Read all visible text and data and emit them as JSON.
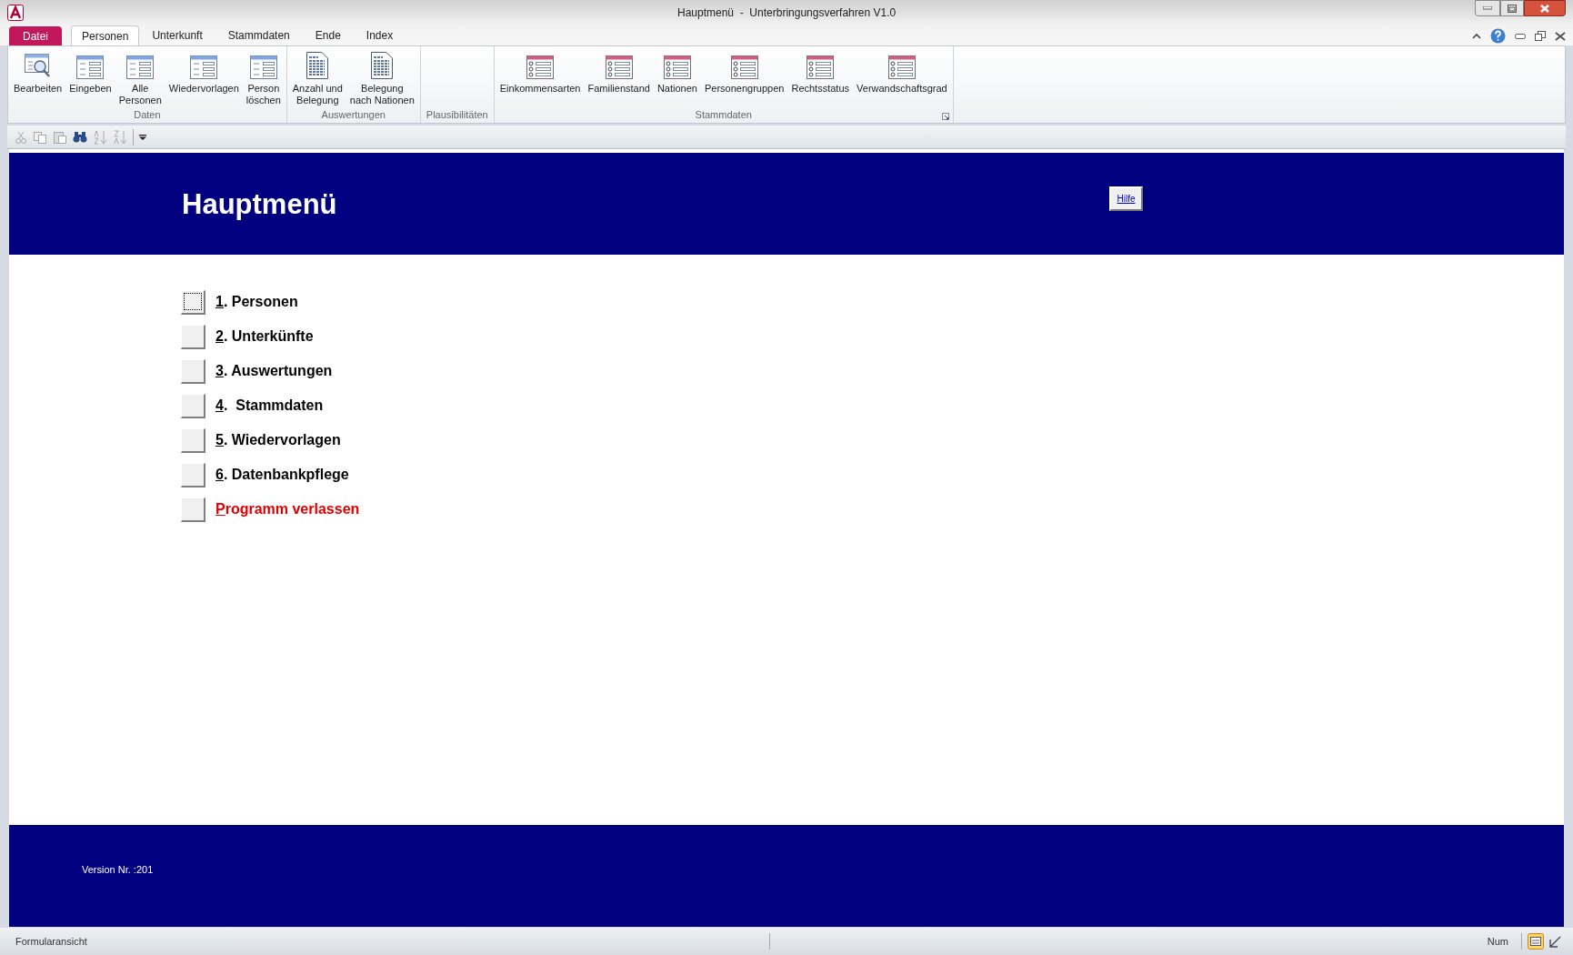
{
  "window": {
    "title": "Hauptmenü  -  Unterbringungsverfahren V1.0"
  },
  "file_tab": {
    "label": "Datei"
  },
  "tabs": [
    {
      "label": "Personen",
      "selected": true
    },
    {
      "label": "Unterkunft",
      "selected": false
    },
    {
      "label": "Stammdaten",
      "selected": false
    },
    {
      "label": "Ende",
      "selected": false
    },
    {
      "label": "Index",
      "selected": false
    }
  ],
  "ribbon_groups": [
    {
      "label": "Daten",
      "items": [
        {
          "label": "Bearbeiten",
          "kind": "search"
        },
        {
          "label": "Eingeben",
          "kind": "form"
        },
        {
          "label": "Alle\nPersonen",
          "kind": "form"
        },
        {
          "label": "Wiedervorlagen",
          "kind": "form"
        },
        {
          "label": "Person\nlöschen",
          "kind": "form"
        }
      ]
    },
    {
      "label": "Auswertungen",
      "items": [
        {
          "label": "Anzahl und\nBelegung",
          "kind": "report"
        },
        {
          "label": "Belegung\nnach Nationen",
          "kind": "report"
        }
      ]
    },
    {
      "label": "Plausibilitäten"
    },
    {
      "label": "Stammdaten",
      "launcher": true,
      "items": [
        {
          "label": "Einkommensarten",
          "kind": "table"
        },
        {
          "label": "Familienstand",
          "kind": "table"
        },
        {
          "label": "Nationen",
          "kind": "table"
        },
        {
          "label": "Personengruppen",
          "kind": "table"
        },
        {
          "label": "Rechtsstatus",
          "kind": "table"
        },
        {
          "label": "Verwandschaftsgrad",
          "kind": "table"
        }
      ]
    }
  ],
  "form": {
    "title": "Hauptmenü",
    "help_button": "Hilfe",
    "menu": [
      {
        "key": "1",
        "rest": ". Personen",
        "kind": "normal",
        "focused": true
      },
      {
        "key": "2",
        "rest": ". Unterkünfte",
        "kind": "normal",
        "focused": false
      },
      {
        "key": "3",
        "rest": ". Auswertungen",
        "kind": "normal",
        "focused": false
      },
      {
        "key": "4",
        "rest": ".  Stammdaten",
        "kind": "normal",
        "focused": false
      },
      {
        "key": "5",
        "rest": ". Wiedervorlagen",
        "kind": "normal",
        "focused": false
      },
      {
        "key": "6",
        "rest": ". Datenbankpflege",
        "kind": "normal",
        "focused": false
      },
      {
        "key": "P",
        "rest": "rogramm verlassen",
        "kind": "exit",
        "focused": false
      }
    ],
    "version": "Version Nr. :201"
  },
  "status_bar": {
    "view": "Formularansicht",
    "indicator": "Num"
  }
}
